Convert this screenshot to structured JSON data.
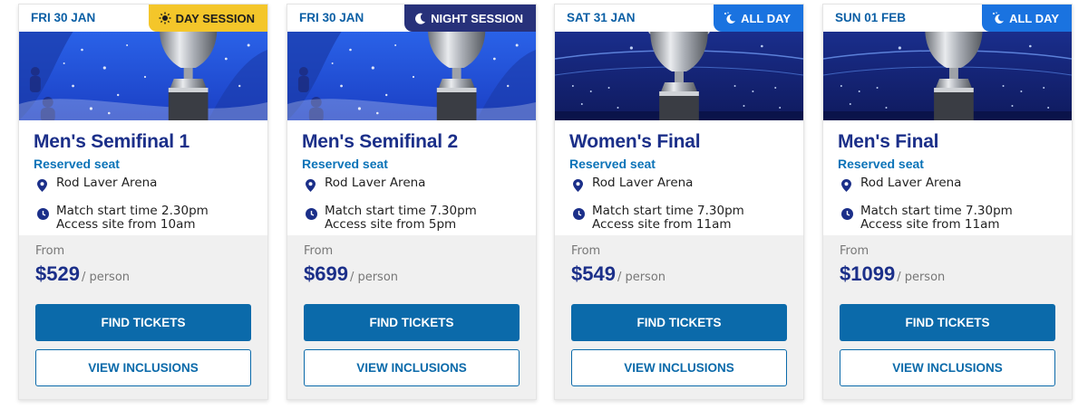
{
  "cards": [
    {
      "date": "FRI 30 JAN",
      "session": "DAY SESSION",
      "session_icon": "sun-icon",
      "title": "Men's Semifinal 1",
      "seat": "Reserved seat",
      "venue": "Rod Laver Arena",
      "start": "Match start time 2.30pm",
      "access": "Access site from 10am",
      "from": "From",
      "price": "$529",
      "per": "/ person",
      "find": "FIND TICKETS",
      "view": "VIEW INCLUSIONS"
    },
    {
      "date": "FRI 30 JAN",
      "session": "NIGHT SESSION",
      "session_icon": "moon-icon",
      "title": "Men's Semifinal 2",
      "seat": "Reserved seat",
      "venue": "Rod Laver Arena",
      "start": "Match start time 7.30pm",
      "access": "Access site from 5pm",
      "from": "From",
      "price": "$699",
      "per": "/ person",
      "find": "FIND TICKETS",
      "view": "VIEW INCLUSIONS"
    },
    {
      "date": "SAT 31 JAN",
      "session": "ALL DAY",
      "session_icon": "sun-moon-icon",
      "title": "Women's Final",
      "seat": "Reserved seat",
      "venue": "Rod Laver Arena",
      "start": "Match start time 7.30pm",
      "access": "Access site from 11am",
      "from": "From",
      "price": "$549",
      "per": "/ person",
      "find": "FIND TICKETS",
      "view": "VIEW INCLUSIONS"
    },
    {
      "date": "SUN 01 FEB",
      "session": "ALL DAY",
      "session_icon": "sun-moon-icon",
      "title": "Men's Final",
      "seat": "Reserved seat",
      "venue": "Rod Laver Arena",
      "start": "Match start time 7.30pm",
      "access": "Access site from 11am",
      "from": "From",
      "price": "$1099",
      "per": "/ person",
      "find": "FIND TICKETS",
      "view": "VIEW INCLUSIONS"
    }
  ],
  "colors": {
    "title": "#1b2f89",
    "accent": "#0b6aaa",
    "day_tag": "#f4c62a",
    "night_tag": "#27317a",
    "allday_tag": "#1a73e0"
  }
}
